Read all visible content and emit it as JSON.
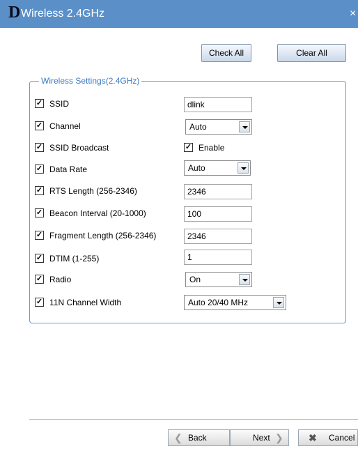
{
  "window": {
    "logo": "D",
    "title": "Wireless 2.4GHz",
    "close_glyph": "×"
  },
  "toolbar": {
    "check_all": "Check All",
    "clear_all": "Clear All"
  },
  "group": {
    "legend": "Wireless Settings(2.4GHz)"
  },
  "fields": [
    {
      "label": "SSID",
      "checked": true,
      "type": "text",
      "value": "dlink"
    },
    {
      "label": "Channel",
      "checked": true,
      "type": "select",
      "value": "Auto"
    },
    {
      "label": "SSID Broadcast",
      "checked": true,
      "type": "checkbox",
      "value": "Enable",
      "value_checked": true
    },
    {
      "label": "Data Rate",
      "checked": true,
      "type": "select",
      "value": "Auto"
    },
    {
      "label": "RTS Length (256-2346)",
      "checked": true,
      "type": "text",
      "value": "2346"
    },
    {
      "label": "Beacon Interval (20-1000)",
      "checked": true,
      "type": "text",
      "value": "100"
    },
    {
      "label": "Fragment Length (256-2346)",
      "checked": true,
      "type": "text",
      "value": "2346"
    },
    {
      "label": "DTIM (1-255)",
      "checked": true,
      "type": "text",
      "value": "1"
    },
    {
      "label": "Radio",
      "checked": true,
      "type": "select",
      "value": "On"
    },
    {
      "label": "11N Channel Width",
      "checked": true,
      "type": "select",
      "value": "Auto 20/40 MHz"
    }
  ],
  "footer": {
    "back": "Back",
    "next": "Next",
    "cancel": "Cancel"
  },
  "icons": {
    "back": "back-arrow-icon",
    "next": "next-arrow-icon",
    "cancel": "cancel-x-icon"
  },
  "colors": {
    "titlebar": "#5b8fc8",
    "group_border": "#6d9ad2",
    "legend_text": "#3d7bc3"
  }
}
